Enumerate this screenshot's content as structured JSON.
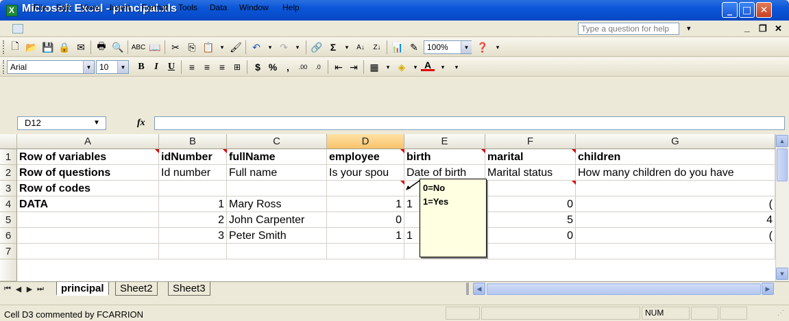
{
  "window": {
    "title": "Microsoft Excel - principal.xls",
    "help_placeholder": "Type a question for help"
  },
  "menu": [
    "File",
    "Edit",
    "View",
    "Insert",
    "Format",
    "Tools",
    "Data",
    "Window",
    "Help"
  ],
  "formatting": {
    "font": "Arial",
    "size": "10",
    "zoom": "100%",
    "bold": "B",
    "italic": "I",
    "underline": "U",
    "currency": "$",
    "percent": "%",
    "comma": ","
  },
  "formula_bar": {
    "name_box": "D12",
    "fx_label": "fx",
    "value": ""
  },
  "columns": [
    "A",
    "B",
    "C",
    "D",
    "E",
    "F",
    "G"
  ],
  "rows": [
    "1",
    "2",
    "3",
    "4",
    "5",
    "6",
    "7"
  ],
  "cells": {
    "r1": [
      "Row of variables",
      "idNumber",
      "fullName",
      "employee",
      "birth",
      "marital",
      "children"
    ],
    "r2": [
      "Row of questions",
      "Id number",
      "Full name",
      "Is your spou",
      "Date of birth",
      "Marital status",
      "How many children do you have"
    ],
    "r3": [
      "Row of codes",
      "",
      "",
      "",
      "",
      "",
      ""
    ],
    "r4": [
      "DATA",
      "1",
      "Mary Ross",
      "1",
      "1",
      "0",
      "("
    ],
    "r5": [
      "",
      "2",
      "John Carpenter",
      "0",
      "",
      "5",
      "4"
    ],
    "r6": [
      "",
      "3",
      "Peter Smith",
      "1",
      "1",
      "0",
      "("
    ]
  },
  "comment": {
    "line1": "0=No",
    "line2": "1=Yes"
  },
  "sheets": [
    "principal",
    "Sheet2",
    "Sheet3"
  ],
  "active_sheet": "principal",
  "status": {
    "message": "Cell D3 commented by FCARRION",
    "num": "NUM"
  }
}
